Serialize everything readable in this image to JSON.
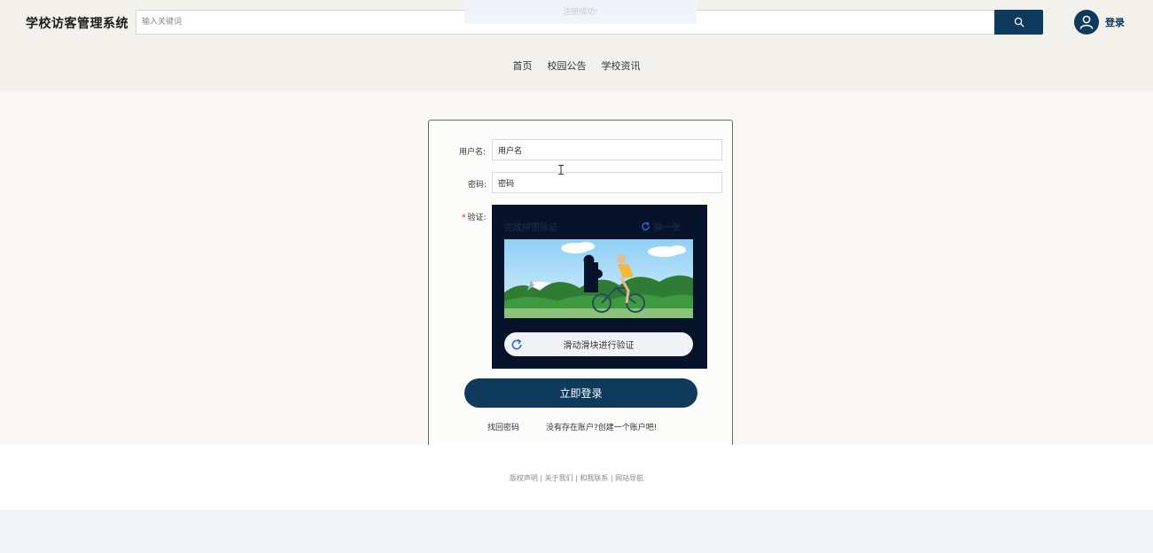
{
  "header": {
    "site_title": "学校访客管理系统",
    "search_placeholder": "输入关键词",
    "toast_text": "注册成功!",
    "login_label": "登录"
  },
  "nav": {
    "items": [
      "首页",
      "校园公告",
      "学校资讯"
    ]
  },
  "login_form": {
    "username_label": "用户名:",
    "username_value": "用户名",
    "password_label": "密码:",
    "password_value": "密码",
    "verify_label": "验证:",
    "captcha": {
      "title": "完成拼图验证",
      "refresh_label": "换一张",
      "slider_text": "滑动滑块进行验证"
    },
    "submit_label": "立即登录",
    "forgot_password": "找回密码",
    "register_prompt": "没有存在账户?创建一个账户吧!"
  },
  "footer": {
    "links": [
      "版权声明",
      "关于我们",
      "和我联系",
      "网站导航"
    ]
  },
  "colors": {
    "primary": "#0e3a5c",
    "header_bg": "#f3f1ec",
    "main_bg": "#f9f8f4"
  }
}
